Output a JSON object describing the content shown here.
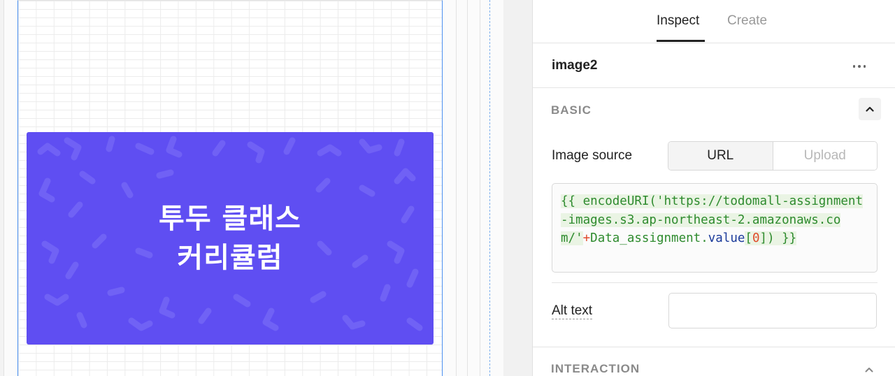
{
  "inspector": {
    "tabs": [
      {
        "label": "Inspect",
        "active": true
      },
      {
        "label": "Create",
        "active": false
      }
    ],
    "component_name": "image2",
    "sections": {
      "basic": {
        "title": "BASIC"
      },
      "interaction": {
        "title": "INTERACTION"
      }
    },
    "image_source": {
      "label": "Image source",
      "options": [
        "URL",
        "Upload"
      ],
      "selected": "URL",
      "code": {
        "open": "{{ ",
        "func": "encodeURI(",
        "str": "'https://todomall-assignment-images.s3.ap-northeast-2.amazonaws.com/'",
        "plus": "+",
        "var": "Data_assignment.",
        "prop": "value",
        "bracket_open": "[",
        "index": "0",
        "bracket_close": "]",
        "close": ") }}"
      }
    },
    "alt_text": {
      "label": "Alt text",
      "value": ""
    }
  },
  "canvas": {
    "banner": {
      "line1": "투두 클래스",
      "line2": "커리큘럼",
      "color": "#5f4ef2"
    }
  },
  "colors": {
    "accent_blue": "#4a8ff0",
    "banner_purple": "#5f4ef2"
  }
}
